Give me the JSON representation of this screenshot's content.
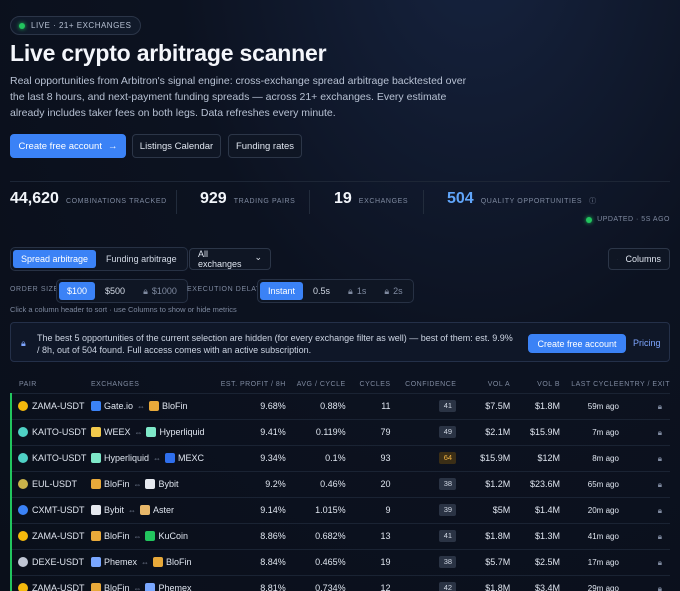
{
  "hero": {
    "badge": "LIVE · 21+ EXCHANGES",
    "title": "Live crypto arbitrage scanner",
    "lead": "Real opportunities from Arbitron's signal engine: cross-exchange spread arbitrage backtested over the last 8 hours, and next-payment funding spreads — across 21+ exchanges. Every estimate already includes taker fees on both legs. Data refreshes every minute.",
    "cta_primary": "Create free account",
    "cta_arrow": "→",
    "cta_listings": "Listings Calendar",
    "cta_funding": "Funding rates"
  },
  "stats": [
    {
      "value": "44,620",
      "label": "COMBINATIONS TRACKED"
    },
    {
      "value": "929",
      "label": "TRADING PAIRS"
    },
    {
      "value": "19",
      "label": "EXCHANGES"
    },
    {
      "value": "504",
      "label": "QUALITY OPPORTUNITIES",
      "info": "ⓘ"
    }
  ],
  "updated": "UPDATED · 5S AGO",
  "tabs": {
    "spread": "Spread arbitrage",
    "funding": "Funding arbitrage"
  },
  "exchange_filter": {
    "value": "All exchanges",
    "chevron": "⌄"
  },
  "columns_button": "Columns",
  "order_size": {
    "label": "ORDER SIZE",
    "options": [
      "$100",
      "$500",
      "$1000"
    ]
  },
  "execution_delay": {
    "label": "EXECUTION DELAY",
    "options": [
      "Instant",
      "0.5s",
      "1s",
      "2s"
    ]
  },
  "hint": "Click a column header to sort · use Columns to show or hide metrics",
  "banner": {
    "text": "The best 5 opportunities of the current selection are hidden (for every exchange filter as well) — best of them: est. 9.9% / 8h, out of 504 found. Full access comes with an active subscription.",
    "cta": "Create free account",
    "pricing": "Pricing"
  },
  "table": {
    "headers": [
      "PAIR",
      "EXCHANGES",
      "EST. PROFIT / 8H",
      "AVG / CYCLE",
      "CYCLES",
      "CONFIDENCE",
      "VOL A",
      "VOL B",
      "LAST CYCLE",
      "ENTRY / EXIT"
    ],
    "rows": [
      {
        "pair": "ZAMA-USDT",
        "pair_color": "#f5b90c",
        "ex_a": "Gate.io",
        "ex_a_color": "#3b82f6",
        "ex_b": "BloFin",
        "ex_b_color": "#e8a93a",
        "profit": "9.68%",
        "avg": "0.88%",
        "cycles": "11",
        "confidence": "41",
        "conf_style": "gray",
        "vol_a": "$7.5M",
        "vol_b": "$1.8M",
        "last": "59m ago",
        "last_green": false
      },
      {
        "pair": "KAITO-USDT",
        "pair_color": "#4fd1c5",
        "ex_a": "WEEX",
        "ex_a_color": "#f2c94c",
        "ex_b": "Hyperliquid",
        "ex_b_color": "#7ee8c8",
        "profit": "9.41%",
        "avg": "0.119%",
        "cycles": "79",
        "confidence": "49",
        "conf_style": "gray",
        "vol_a": "$2.1M",
        "vol_b": "$15.9M",
        "last": "7m ago",
        "last_green": true
      },
      {
        "pair": "KAITO-USDT",
        "pair_color": "#4fd1c5",
        "ex_a": "Hyperliquid",
        "ex_a_color": "#7ee8c8",
        "ex_b": "MEXC",
        "ex_b_color": "#2f6fed",
        "profit": "9.34%",
        "avg": "0.1%",
        "cycles": "93",
        "confidence": "64",
        "conf_style": "amber",
        "vol_a": "$15.9M",
        "vol_b": "$12M",
        "last": "8m ago",
        "last_green": true
      },
      {
        "pair": "EUL-USDT",
        "pair_color": "#c9b24a",
        "ex_a": "BloFin",
        "ex_a_color": "#e8a93a",
        "ex_b": "Bybit",
        "ex_b_color": "#e6e9ef",
        "profit": "9.2%",
        "avg": "0.46%",
        "cycles": "20",
        "confidence": "38",
        "conf_style": "gray",
        "vol_a": "$1.2M",
        "vol_b": "$23.6M",
        "last": "65m ago",
        "last_green": false
      },
      {
        "pair": "CXMT-USDT",
        "pair_color": "#3b82f6",
        "ex_a": "Bybit",
        "ex_a_color": "#e6e9ef",
        "ex_b": "Aster",
        "ex_b_color": "#e8b86a",
        "profit": "9.14%",
        "avg": "1.015%",
        "cycles": "9",
        "confidence": "39",
        "conf_style": "gray",
        "vol_a": "$5M",
        "vol_b": "$1.4M",
        "last": "20m ago",
        "last_green": true
      },
      {
        "pair": "ZAMA-USDT",
        "pair_color": "#f5b90c",
        "ex_a": "BloFin",
        "ex_a_color": "#e8a93a",
        "ex_b": "KuCoin",
        "ex_b_color": "#22c55e",
        "profit": "8.86%",
        "avg": "0.682%",
        "cycles": "13",
        "confidence": "41",
        "conf_style": "gray",
        "vol_a": "$1.8M",
        "vol_b": "$1.3M",
        "last": "41m ago",
        "last_green": false
      },
      {
        "pair": "DEXE-USDT",
        "pair_color": "#c0c6d4",
        "ex_a": "Phemex",
        "ex_a_color": "#7aa7ff",
        "ex_b": "BloFin",
        "ex_b_color": "#e8a93a",
        "profit": "8.84%",
        "avg": "0.465%",
        "cycles": "19",
        "confidence": "38",
        "conf_style": "gray",
        "vol_a": "$5.7M",
        "vol_b": "$2.5M",
        "last": "17m ago",
        "last_green": true
      },
      {
        "pair": "ZAMA-USDT",
        "pair_color": "#f5b90c",
        "ex_a": "BloFin",
        "ex_a_color": "#e8a93a",
        "ex_b": "Phemex",
        "ex_b_color": "#7aa7ff",
        "profit": "8.81%",
        "avg": "0.734%",
        "cycles": "12",
        "confidence": "42",
        "conf_style": "gray",
        "vol_a": "$1.8M",
        "vol_b": "$3.4M",
        "last": "29m ago",
        "last_green": false
      }
    ]
  },
  "colors": {
    "accent": "#3b82f6",
    "positive": "#4ade80",
    "live": "#22c55e"
  },
  "icons": {
    "lock": "lock-icon",
    "columns": "columns-icon",
    "swap": "swap-arrows-icon"
  }
}
